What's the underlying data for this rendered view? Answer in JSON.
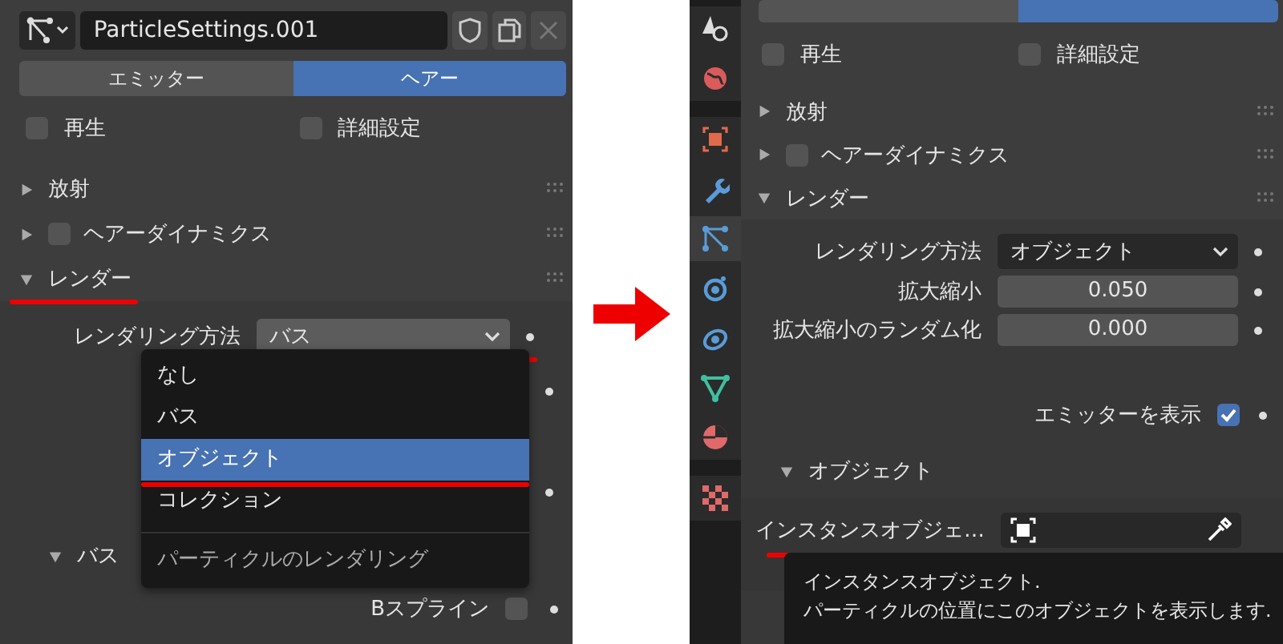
{
  "left_panel": {
    "header": {
      "name_field": "ParticleSettings.001"
    },
    "tabs": [
      {
        "label": "エミッター",
        "selected": false
      },
      {
        "label": "ヘアー",
        "selected": true
      }
    ],
    "toggles": [
      {
        "label": "再生",
        "checked": false
      },
      {
        "label": "詳細設定",
        "checked": false
      }
    ],
    "sections": [
      {
        "label": "放射",
        "expanded": false,
        "kind": "plain",
        "underlined": false
      },
      {
        "label": "ヘアーダイナミクス",
        "expanded": false,
        "kind": "checkbox",
        "checked": false,
        "underlined": false
      },
      {
        "label": "レンダー",
        "expanded": true,
        "kind": "plain",
        "underlined": true
      }
    ],
    "render_method": {
      "label": "レンダリング方法",
      "value": "バス",
      "underlined": true
    },
    "dropdown_menu": {
      "items": [
        {
          "label": "なし",
          "selected": false,
          "underlined": false
        },
        {
          "label": "バス",
          "selected": false,
          "underlined": false
        },
        {
          "label": "オブジェクト",
          "selected": true,
          "underlined": true
        },
        {
          "label": "コレクション",
          "selected": false,
          "underlined": false
        }
      ],
      "footer": "パーティクルのレンダリング"
    },
    "subsection": {
      "label": "バス",
      "expanded": true
    },
    "rows": [
      {
        "label": "Bスプライン",
        "checked": false
      }
    ]
  },
  "right_panel": {
    "tabs": [
      {
        "selected": false
      },
      {
        "selected": true
      }
    ],
    "toggles": [
      {
        "label": "再生",
        "checked": false
      },
      {
        "label": "詳細設定",
        "checked": false
      }
    ],
    "sections": [
      {
        "label": "放射",
        "expanded": false,
        "kind": "plain"
      },
      {
        "label": "ヘアーダイナミクス",
        "expanded": false,
        "kind": "checkbox",
        "checked": false
      },
      {
        "label": "レンダー",
        "expanded": true,
        "kind": "plain"
      }
    ],
    "render_method": {
      "label": "レンダリング方法",
      "value": "オブジェクト"
    },
    "fields": [
      {
        "label": "拡大縮小",
        "value": "0.050"
      },
      {
        "label": "拡大縮小のランダム化",
        "value": "0.000"
      }
    ],
    "show_emitter": {
      "label": "エミッターを表示",
      "checked": true
    },
    "subsection": {
      "label": "オブジェクト",
      "expanded": true
    },
    "instance_object": {
      "label": "インスタンスオブジェ…",
      "underlined": true
    },
    "tooltip": [
      "インスタンスオブジェクト.",
      "パーティクルの位置にこのオブジェクトを表示します."
    ]
  }
}
